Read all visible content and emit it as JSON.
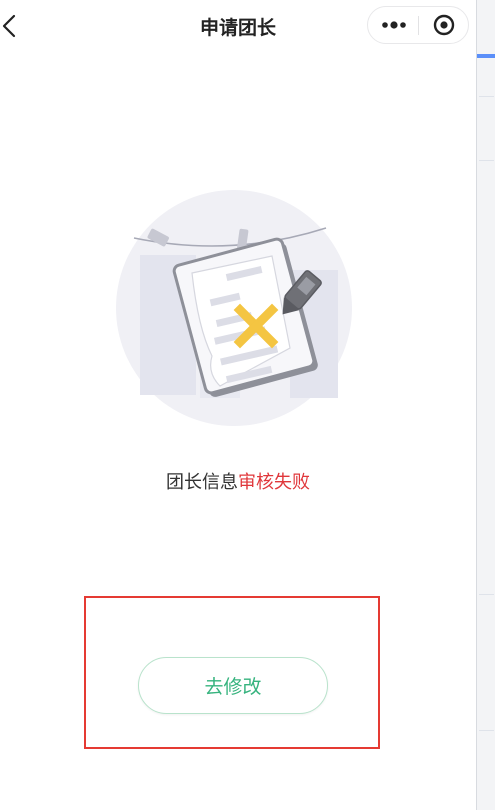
{
  "nav": {
    "title": "申请团长"
  },
  "status": {
    "prefix": "团长信息",
    "highlight": "审核失败"
  },
  "action": {
    "button_label": "去修改"
  },
  "colors": {
    "fail_text": "#e0373b",
    "button_text": "#36b37e",
    "highlight_frame": "#e53a33"
  }
}
